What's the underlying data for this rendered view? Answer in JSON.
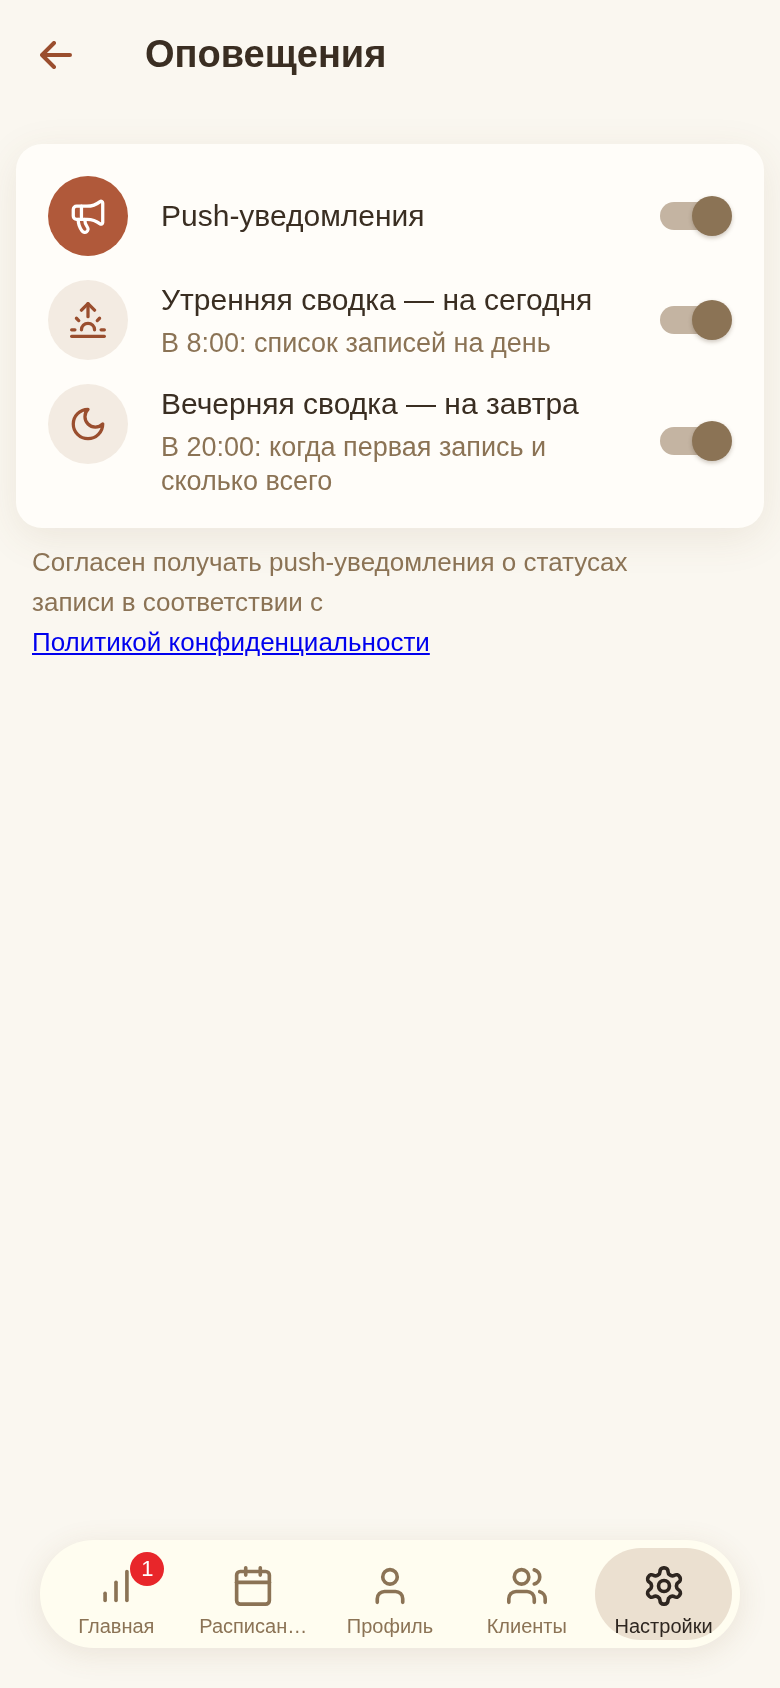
{
  "header": {
    "title": "Оповещения"
  },
  "settings": [
    {
      "kind": "master",
      "title": "Push-уведомления",
      "on": true
    },
    {
      "kind": "summary",
      "title": "Утренняя сводка — на сегодня",
      "subtitle": "В 8:00: список записей на день",
      "on": true
    },
    {
      "kind": "summary",
      "title": "Вечерняя сводка — на завтра",
      "subtitle": "В 20:00: когда первая запись и сколько всего",
      "on": true
    }
  ],
  "consent": {
    "text": "Согласен получать push-уведомления о статусах записи в соответствии с",
    "link": "Политикой конфиденциальности"
  },
  "nav": {
    "items": [
      {
        "label": "Главная",
        "selected": false,
        "badge": "1"
      },
      {
        "label": "Расписан…",
        "selected": false
      },
      {
        "label": "Профиль",
        "selected": false
      },
      {
        "label": "Клиенты",
        "selected": false
      },
      {
        "label": "Настройки",
        "selected": true
      }
    ]
  }
}
